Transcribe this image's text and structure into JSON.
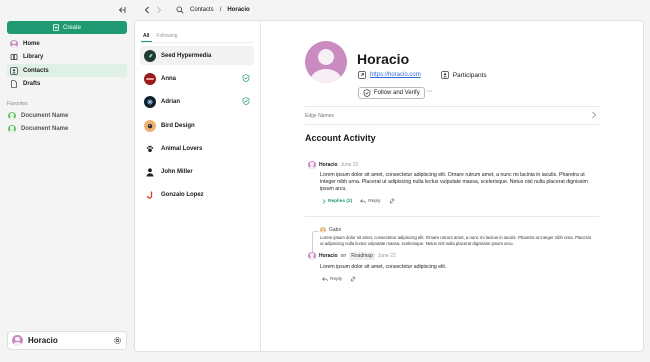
{
  "sidebar": {
    "create_label": "Create",
    "nav": [
      {
        "label": "Home",
        "icon": "avatar-icon"
      },
      {
        "label": "Library",
        "icon": "book-icon"
      },
      {
        "label": "Contacts",
        "icon": "contacts-icon",
        "active": true
      },
      {
        "label": "Drafts",
        "icon": "file-icon"
      }
    ],
    "favorites_label": "Favorites",
    "favorites": [
      "Document Name",
      "Document Name"
    ],
    "user_name": "Horacio"
  },
  "topbar": {
    "breadcrumb_root": "Contacts",
    "breadcrumb_sep": "/",
    "breadcrumb_current": "Horacio"
  },
  "contacts_list": {
    "tabs": [
      "All",
      "Following"
    ],
    "items": [
      {
        "name": "Seed Hypermedia",
        "verified": false,
        "logo_color": "#1f3b30"
      },
      {
        "name": "Anna",
        "verified": true,
        "logo_color": "#9a1b1b"
      },
      {
        "name": "Adrian",
        "verified": true,
        "logo_color": "#10202a"
      },
      {
        "name": "Bird Design",
        "verified": false,
        "logo_color": "#d88a4a"
      },
      {
        "name": "Animal Lovers",
        "verified": false,
        "logo_color": "#ffffff"
      },
      {
        "name": "John Miller",
        "verified": false,
        "logo_color": "#ffffff"
      },
      {
        "name": "Gonzalo Lopez",
        "verified": false,
        "logo_color": "#ffffff"
      }
    ]
  },
  "profile": {
    "name": "Horacio",
    "site_link": "https://horacio.com",
    "participants_label": "Participants",
    "follow_label": "Follow and Verify",
    "more_label": "···",
    "edge_names_label": "Edge Names",
    "activity_title": "Account Activity"
  },
  "activity": [
    {
      "author": "Horacio",
      "date": "June 22",
      "body": "Lorem ipsum dolor sit amet, consectetur adipiscing elit. Ornare rutrum amet, a nunc mi lacinia in iaculis. Pharetra ut integer nibh urna. Placerat ut adipiscing nulla lectus vulputate massa, scelerisque. Netus nisl nulla placerat dignissim ipsum arcu.",
      "replies_label": "Replies (2)",
      "reply_label": "Reply"
    },
    {
      "quoted_author": "Gabo",
      "quoted_body": "Lorem ipsum dolor sit amet, consectetur adipiscing elit. Ornare rutrum amet, a nunc mi lacinia in iaculis. Pharetra ut integer nibh urna. Placerat ut adipiscing nulla lectus vulputate massa, scelerisque. Netus nisl nulla placerat dignissim ipsum arcu.",
      "author": "Horacio",
      "on_label": "on",
      "target": "Roadmap",
      "date": "June 22",
      "body": "Lorem ipsum dolor sit amet, consectetur adipiscing elit.",
      "reply_label": "Reply"
    }
  ],
  "colors": {
    "accent": "#1f9a73",
    "link": "#2f6bd8",
    "avatar": "#c98bc0"
  }
}
